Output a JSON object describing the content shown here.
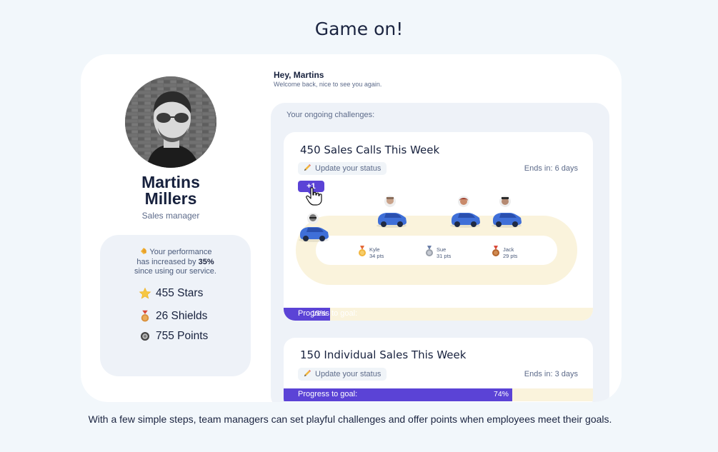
{
  "page": {
    "title": "Game on!",
    "caption": "With a few simple steps, team managers can set playful challenges and offer points when employees meet their goals."
  },
  "profile": {
    "first_name": "Martins",
    "last_name": "Millers",
    "role": "Sales manager"
  },
  "performance": {
    "line1": "Your performance",
    "line2_prefix": "has increased by ",
    "line2_value": "35%",
    "line3": "since using our service.",
    "stats": [
      {
        "icon": "star-icon",
        "label": "455 Stars"
      },
      {
        "icon": "shield-medal-icon",
        "label": "26 Shields"
      },
      {
        "icon": "coin-icon",
        "label": "755 Points"
      }
    ]
  },
  "greeting": {
    "title": "Hey, Martins",
    "subtitle": "Welcome back, nice to see you again."
  },
  "challenges": {
    "label": "Your ongoing challenges:",
    "items": [
      {
        "title": "450 Sales Calls This Week",
        "status_button": "Update your status",
        "ends": "Ends in: 6 days",
        "plus_badge": "+1",
        "progress_label": "Progress to goal:",
        "progress_pct": "15%",
        "progress_value": 15,
        "leaderboard": [
          {
            "name": "Kyle",
            "pts": "34 pts",
            "medal": "gold"
          },
          {
            "name": "Sue",
            "pts": "31 pts",
            "medal": "silver"
          },
          {
            "name": "Jack",
            "pts": "29 pts",
            "medal": "bronze"
          }
        ]
      },
      {
        "title": "150 Individual Sales This Week",
        "status_button": "Update your status",
        "ends": "Ends in: 3 days",
        "progress_label": "Progress to goal:",
        "progress_pct": "74%",
        "progress_value": 74
      }
    ]
  },
  "colors": {
    "accent": "#5b43d6",
    "track": "#faf3dc",
    "car": "#3f6fd8"
  }
}
